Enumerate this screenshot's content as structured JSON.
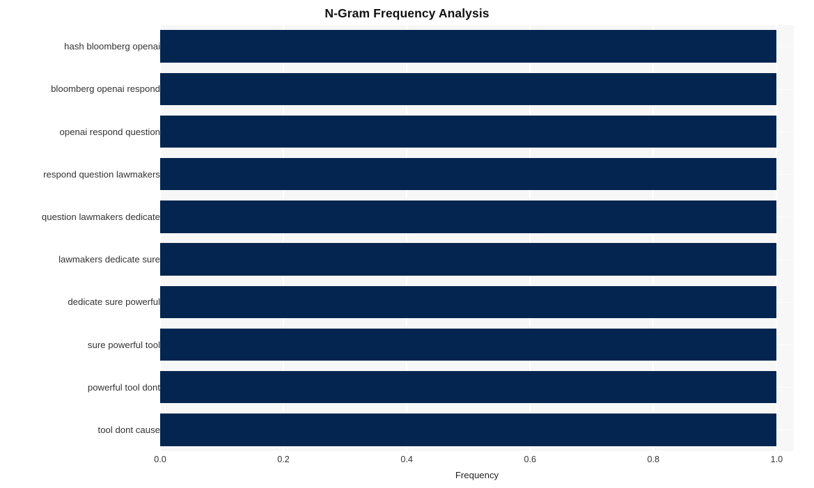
{
  "chart_data": {
    "type": "bar",
    "orientation": "horizontal",
    "title": "N-Gram Frequency Analysis",
    "xlabel": "Frequency",
    "ylabel": "",
    "categories": [
      "hash bloomberg openai",
      "bloomberg openai respond",
      "openai respond question",
      "respond question lawmakers",
      "question lawmakers dedicate",
      "lawmakers dedicate sure",
      "dedicate sure powerful",
      "sure powerful tool",
      "powerful tool dont",
      "tool dont cause"
    ],
    "values": [
      1.0,
      1.0,
      1.0,
      1.0,
      1.0,
      1.0,
      1.0,
      1.0,
      1.0,
      1.0
    ],
    "xlim": [
      0.0,
      1.0278
    ],
    "xticks": [
      0.0,
      0.2,
      0.4,
      0.6,
      0.8,
      1.0
    ],
    "xtick_labels": [
      "0.0",
      "0.2",
      "0.4",
      "0.6",
      "0.8",
      "1.0"
    ],
    "grid": true,
    "grid_axis": "both",
    "legend": null,
    "bar_color": "#03254F",
    "plot_background": "#F7F7F7",
    "figure_background": "#FFFFFF",
    "gridline_color": "#FFFFFF",
    "title_color": "#111111",
    "tick_label_color": "#333333"
  }
}
